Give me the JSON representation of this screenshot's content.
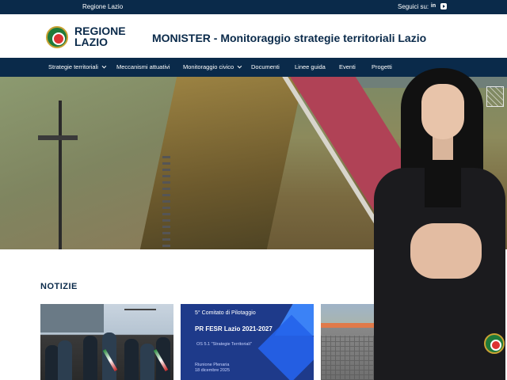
{
  "topbar": {
    "brand": "Regione Lazio",
    "follow_label": "Seguici su:",
    "social": [
      {
        "name": "linkedin",
        "label": "in"
      },
      {
        "name": "youtube",
        "label": ""
      }
    ]
  },
  "header": {
    "logo_text": "REGIONE LAZIO",
    "title": "MONISTER - Monitoraggio strategie territoriali Lazio"
  },
  "nav": {
    "items": [
      {
        "label": "Strategie territoriali",
        "has_dropdown": true
      },
      {
        "label": "Meccanismi attuativi",
        "has_dropdown": false
      },
      {
        "label": "Monitoraggio civico",
        "has_dropdown": true
      },
      {
        "label": "Documenti",
        "has_dropdown": false
      },
      {
        "label": "Linee guida",
        "has_dropdown": false
      },
      {
        "label": "Eventi",
        "has_dropdown": false
      },
      {
        "label": "Progetti",
        "has_dropdown": false
      }
    ]
  },
  "news": {
    "title": "NOTIZIE",
    "cards": [
      {
        "kind": "photo"
      },
      {
        "kind": "poster",
        "line1": "5° Comitato di Pilotaggio",
        "line2": "PR FESR Lazio 2021-2027",
        "line3": "OS 5.1 \"Strategie Territoriali\"",
        "line4": "Riunione Plenaria",
        "line5": "18 dicembre 2025"
      },
      {
        "kind": "photo"
      }
    ]
  },
  "colors": {
    "navy": "#0a2a4a",
    "poster_blue": "#1e3a8a",
    "bike_lane": "#b04256"
  }
}
